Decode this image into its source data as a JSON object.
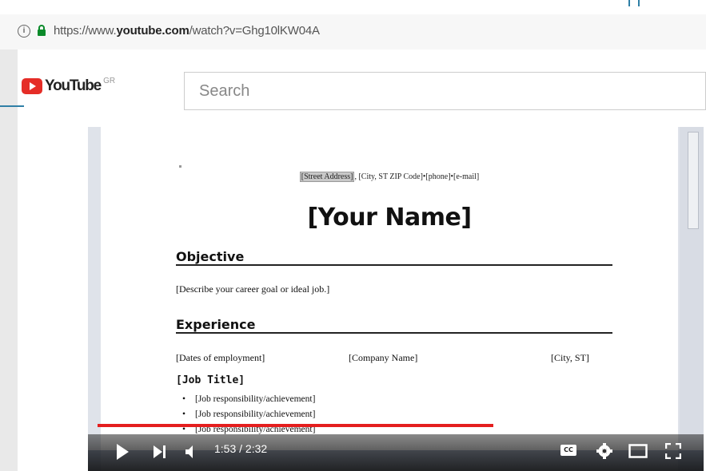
{
  "browser": {
    "url_prefix": "https://www.",
    "url_domain": "youtube.com",
    "url_path": "/watch?v=Ghg10lKW04A"
  },
  "youtube": {
    "logo_text": "YouTube",
    "region": "GR",
    "search_placeholder": "Search"
  },
  "document": {
    "address_highlight": "[Street Address]",
    "address_rest": ", [City, ST  ZIP Code]•[phone]•[e-mail]",
    "name": "[Your Name]",
    "objective_heading": "Objective",
    "objective_text": "[Describe your career goal or ideal job.]",
    "experience_heading": "Experience",
    "dates": "[Dates of employment]",
    "company": "[Company Name]",
    "city": "[City, ST]",
    "job_title": "[Job Title]",
    "bullets": [
      "[Job responsibility/achievement]",
      "[Job responsibility/achievement]",
      "[Job responsibility/achievement]"
    ]
  },
  "player": {
    "time": "1:53 / 2:32",
    "progress": 0.73,
    "cc_label": "CC",
    "colors": {
      "progress": "#e41e1e"
    }
  }
}
